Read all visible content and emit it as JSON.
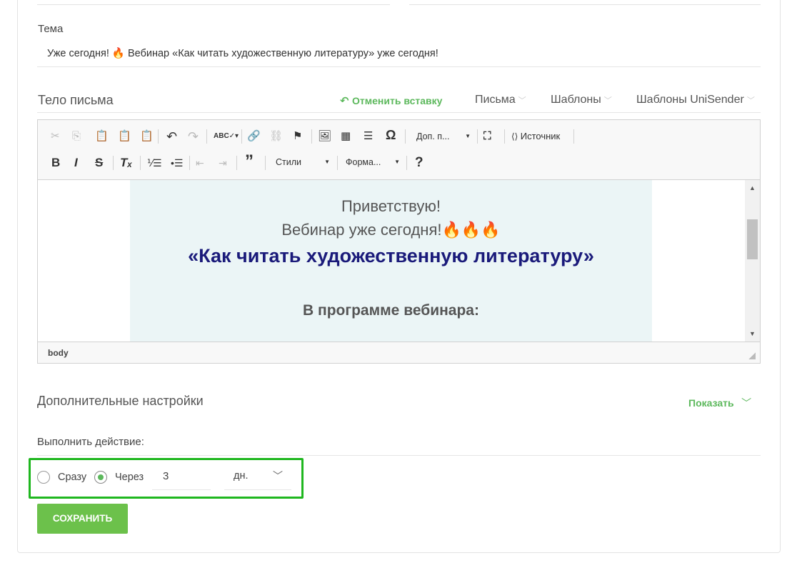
{
  "subject": {
    "label": "Тема",
    "value": "Уже сегодня! 🔥 Вебинар «Как читать художественную литературу» уже сегодня!"
  },
  "body_section": {
    "title": "Тело письма",
    "undo_paste": "Отменить вставку",
    "menus": [
      "Письма",
      "Шаблоны",
      "Шаблоны UniSender"
    ]
  },
  "toolbar": {
    "extra_plugins": "Доп. п...",
    "source": "Источник",
    "styles": "Стили",
    "format": "Форма...",
    "help": "?"
  },
  "email_preview": {
    "greeting": "Приветствую!",
    "webinar_today": "Вебинар уже сегодня!🔥🔥🔥",
    "title": "«Как читать художественную литературу»",
    "program": "В программе вебинара:"
  },
  "status_bar": {
    "path": "body"
  },
  "advanced": {
    "title": "Дополнительные настройки",
    "show": "Показать"
  },
  "action": {
    "label": "Выполнить действие:",
    "options": {
      "immediately": "Сразу",
      "after": "Через"
    },
    "selected": "after",
    "delay_value": "3",
    "unit": "дн."
  },
  "save_button": "СОХРАНИТЬ",
  "colors": {
    "accent": "#5cb85c",
    "button": "#6cc14b",
    "highlight": "#1fb71f",
    "title": "#1a1a7a"
  }
}
